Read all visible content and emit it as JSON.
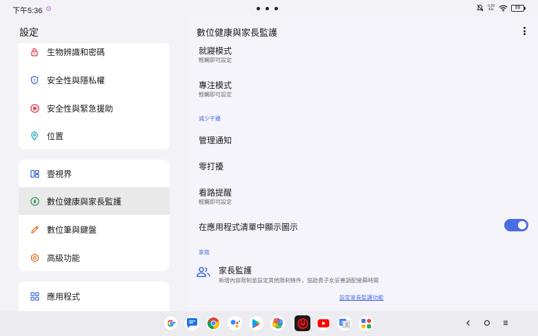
{
  "status_bar": {
    "time": "下午5:36",
    "speed_top": "0.29",
    "speed_bottom": "K/s",
    "battery": "99"
  },
  "left": {
    "title": "設定",
    "group1": [
      {
        "label": "生物辨識和密碼",
        "icon": "lock-icon",
        "color": "#e0313c"
      },
      {
        "label": "安全性與隱私權",
        "icon": "shield-icon",
        "color": "#3a66d8"
      },
      {
        "label": "安全性與緊急援助",
        "icon": "emergency-asterisk-icon",
        "color": "#e0313c"
      },
      {
        "label": "位置",
        "icon": "location-pin-icon",
        "color": "#1aa7b8"
      }
    ],
    "group2": [
      {
        "label": "壹視界",
        "icon": "split-screen-icon",
        "color": "#3a66d8"
      },
      {
        "label": "數位健康與家長監護",
        "icon": "digital-wellbeing-icon",
        "color": "#2e9a5a",
        "selected": true
      },
      {
        "label": "數位筆與鍵盤",
        "icon": "pen-icon",
        "color": "#e86a20"
      },
      {
        "label": "高級功能",
        "icon": "advanced-features-icon",
        "color": "#e86a20"
      }
    ],
    "group3": [
      {
        "label": "應用程式",
        "icon": "apps-grid-icon",
        "color": "#3a66d8"
      }
    ]
  },
  "right": {
    "title": "數位健康與家長監護",
    "bedtime": {
      "title": "就寢模式",
      "subtitle": "輕觸即可設定"
    },
    "focus": {
      "title": "專注模式",
      "subtitle": "輕觸即可設定"
    },
    "section_reduce": "減少干擾",
    "manage_notifications": "管理通知",
    "dnd": "零打擾",
    "heads_up": {
      "title": "看路提醒",
      "subtitle": "輕觸即可設定"
    },
    "show_icon": {
      "title": "在應用程式清單中顯示圖示",
      "toggle_on": true
    },
    "section_family": "家庭",
    "parental": {
      "title": "家長監護",
      "subtitle": "新增內容限制並設定其他限制條件，協助貴子女妥善調配螢幕時間",
      "link": "設定家長監護功能"
    }
  },
  "colors": {
    "accent": "#4a6de5",
    "background": "#f3f2f7",
    "card": "#ffffff",
    "selected": "#e9e9e9"
  },
  "taskbar": {
    "apps": [
      "google-app-icon",
      "messages-icon",
      "chrome-icon",
      "assistant-icon",
      "play-store-icon",
      "photos-icon",
      "power-app-icon",
      "youtube-icon",
      "translate-icon",
      "app-drawer-icon"
    ],
    "nav": [
      "back-icon",
      "home-icon",
      "recents-icon"
    ]
  }
}
